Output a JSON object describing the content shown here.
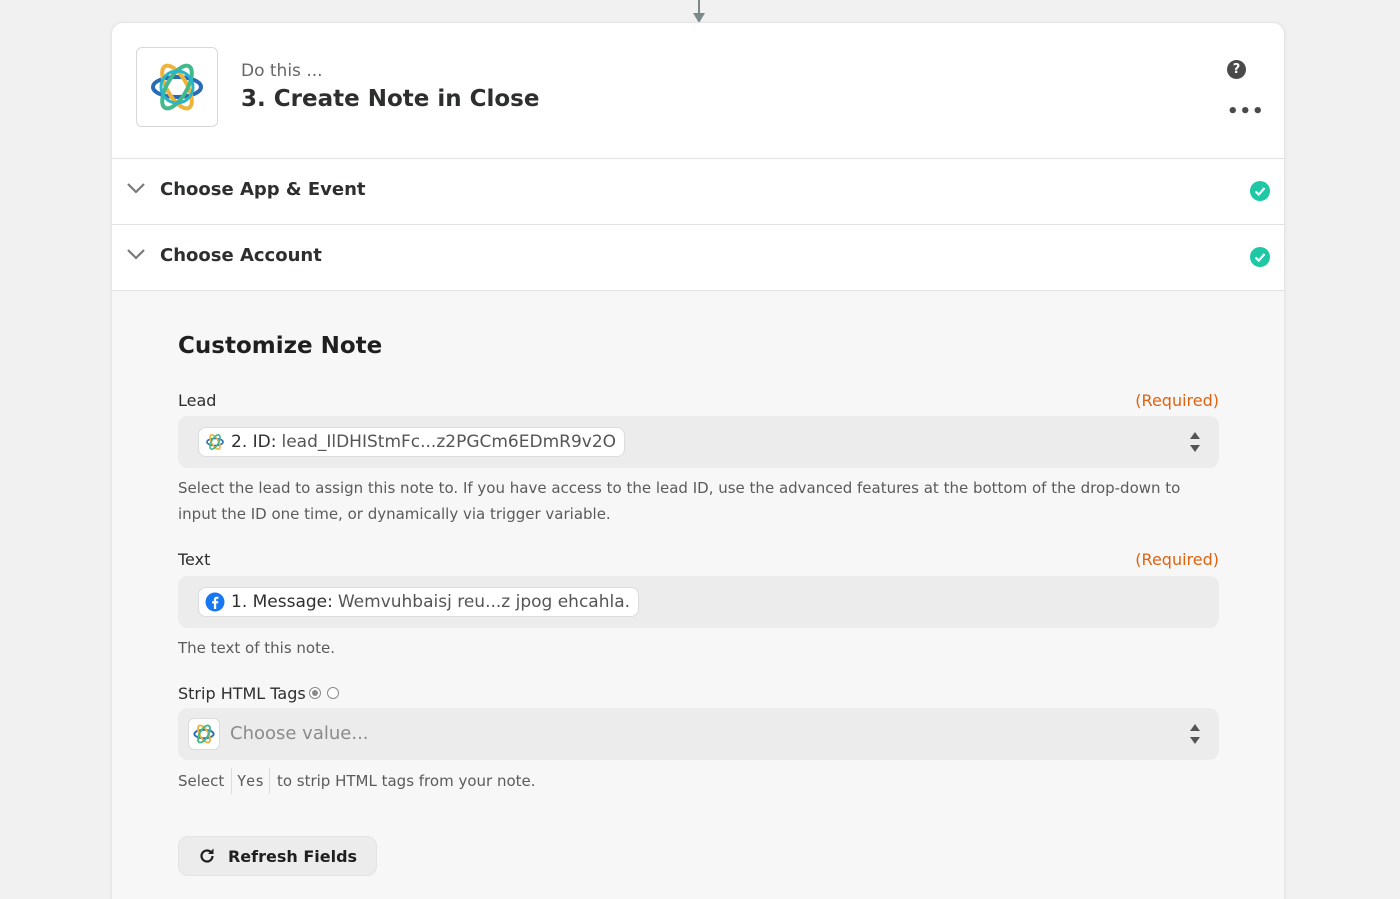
{
  "header": {
    "subtitle": "Do this ...",
    "title": "3. Create Note in Close",
    "help_icon": "question-icon",
    "more_icon": "ellipsis-icon"
  },
  "sections": [
    {
      "label": "Choose App & Event",
      "status": "complete"
    },
    {
      "label": "Choose Account",
      "status": "complete"
    }
  ],
  "customize": {
    "title": "Customize Note",
    "required_label": "(Required)",
    "lead": {
      "label": "Lead",
      "pill_key": "2. ID:",
      "pill_value": "lead_IlDHIStmFc...z2PGCm6EDmR9v2O",
      "help": "Select the lead to assign this note to. If you have access to the lead ID, use the advanced features at the bottom of the drop-down to input the ID one time, or dynamically via trigger variable."
    },
    "text": {
      "label": "Text",
      "pill_key": "1. Message:",
      "pill_value": "Wemvuhbaisj reu...z jpog ehcahla.",
      "help": "The text of this note."
    },
    "strip_html": {
      "label": "Strip HTML Tags",
      "placeholder": "Choose value...",
      "help_prefix": "Select",
      "help_code": "Yes",
      "help_suffix": "to strip HTML tags from your note."
    },
    "refresh_label": "Refresh Fields"
  },
  "colors": {
    "accent_check": "#1fc8a5",
    "required": "#e1620f",
    "facebook": "#1877f2"
  }
}
